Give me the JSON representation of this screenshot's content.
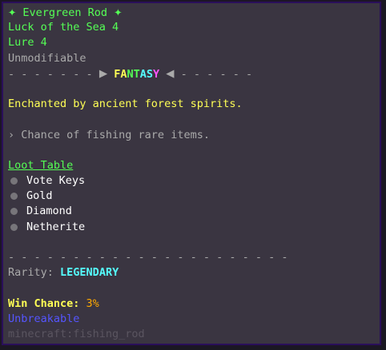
{
  "item": {
    "star_left": "✦",
    "name": "Evergreen Rod",
    "star_right": "✦",
    "enchantments": [
      "Luck of the Sea 4",
      "Lure 4"
    ],
    "modifiable_note": "Unmodifiable",
    "divider_left": "- - - - - - -",
    "divider_right": "- - - - - -",
    "arrow_right": "▶",
    "arrow_left": "◀",
    "category": "FANTASY",
    "lore": "Enchanted by ancient forest spirits.",
    "ability": "› Chance of fishing rare items.",
    "loot_table_title": "Loot Table",
    "loot_table": [
      "Vote Keys",
      "Gold",
      "Diamond",
      "Netherite"
    ],
    "divider_full": "- - - - - - - - - - - - - - - - - - - - - -",
    "rarity_label": "Rarity:",
    "rarity_value": "LEGENDARY",
    "win_chance_label": "Win Chance:",
    "win_chance_value": "3%",
    "unbreakable": "Unbreakable",
    "item_id": "minecraft:fishing_rod"
  },
  "colors": {
    "background": "#3a3541",
    "name": "#55ff55",
    "lore": "#ffff55",
    "rarity": "#55ffff",
    "win_chance": "#ffaa00",
    "unbreakable": "#5555ff",
    "item_id": "#5a5560"
  }
}
